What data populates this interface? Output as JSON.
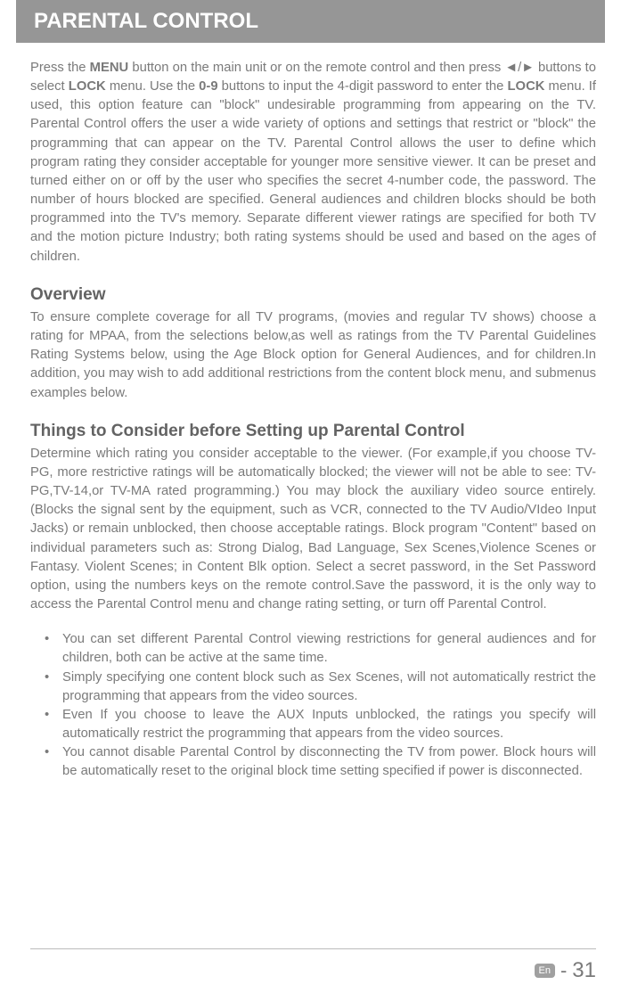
{
  "header": {
    "title": "PARENTAL CONTROL"
  },
  "intro": {
    "text_parts": {
      "p1": "Press the ",
      "menu": "MENU",
      "p2": " button on the main unit or on the remote control and then press ◄/► buttons to select ",
      "lock1": "LOCK",
      "p3": " menu. Use the ",
      "digits": "0-9",
      "p4": " buttons to input the 4-digit password to enter the ",
      "lock2": "LOCK",
      "p5": " menu. If used, this option feature  can \"block\" undesirable programming from appearing on the TV. Parental Control offers the user a wide  variety  of options and settings that restrict or \"block\" the programming that can appear on the TV. Parental Control allows the user to define which program rating they consider acceptable for younger more sensitive viewer. It can be preset and turned either on or off by the user who specifies the secret 4-number code, the password. The number of hours blocked are specified. General audiences and children blocks should be both programmed into the TV's memory. Separate different viewer ratings are specified for both TV and the motion picture Industry;  both rating systems should be used and based on the ages of children."
    }
  },
  "overview": {
    "heading": "Overview",
    "text": "To ensure complete coverage for all TV programs, (movies and regular TV shows) choose a rating for MPAA, from the selections below,as well as ratings from the TV Parental Guidelines Rating Systems below, using the Age Block option for General Audiences, and for children.In addition, you may wish to add additional restrictions from the content block menu, and submenus examples below."
  },
  "consider": {
    "heading": "Things to Consider before Setting up Parental Control",
    "text": "Determine which rating you consider acceptable to the viewer. (For example,if you choose TV-PG, more restrictive ratings will be automatically blocked; the viewer will not be able to see: TV-PG,TV-14,or TV-MA rated programming.) You may block the auxiliary video source entirely. (Blocks the signal sent by the equipment, such as VCR, connected to the TV Audio/VIdeo Input Jacks) or remain unblocked, then choose acceptable ratings. Block program \"Content\" based on individual parameters such as: Strong Dialog, Bad Language, Sex Scenes,Violence Scenes or Fantasy. Violent Scenes; in Content Blk option. Select a secret password, in the Set Password option, using the numbers keys on the remote control.Save the password, it is the only way to access the Parental  Control menu and change rating setting, or turn off Parental Control."
  },
  "bullets": [
    "You can set different Parental Control viewing restrictions for general audiences and for children, both can be active at the same time.",
    "Simply specifying one content block such as Sex Scenes, will not automatically restrict the programming that appears from the video sources.",
    "Even If you choose to leave the AUX Inputs unblocked, the ratings you specify will automatically restrict the programming that appears from the video sources.",
    "You cannot disable Parental Control by disconnecting the TV from power. Block hours will be automatically reset to the original block time setting specified if power is disconnected."
  ],
  "footer": {
    "lang": "En",
    "page": "31"
  }
}
